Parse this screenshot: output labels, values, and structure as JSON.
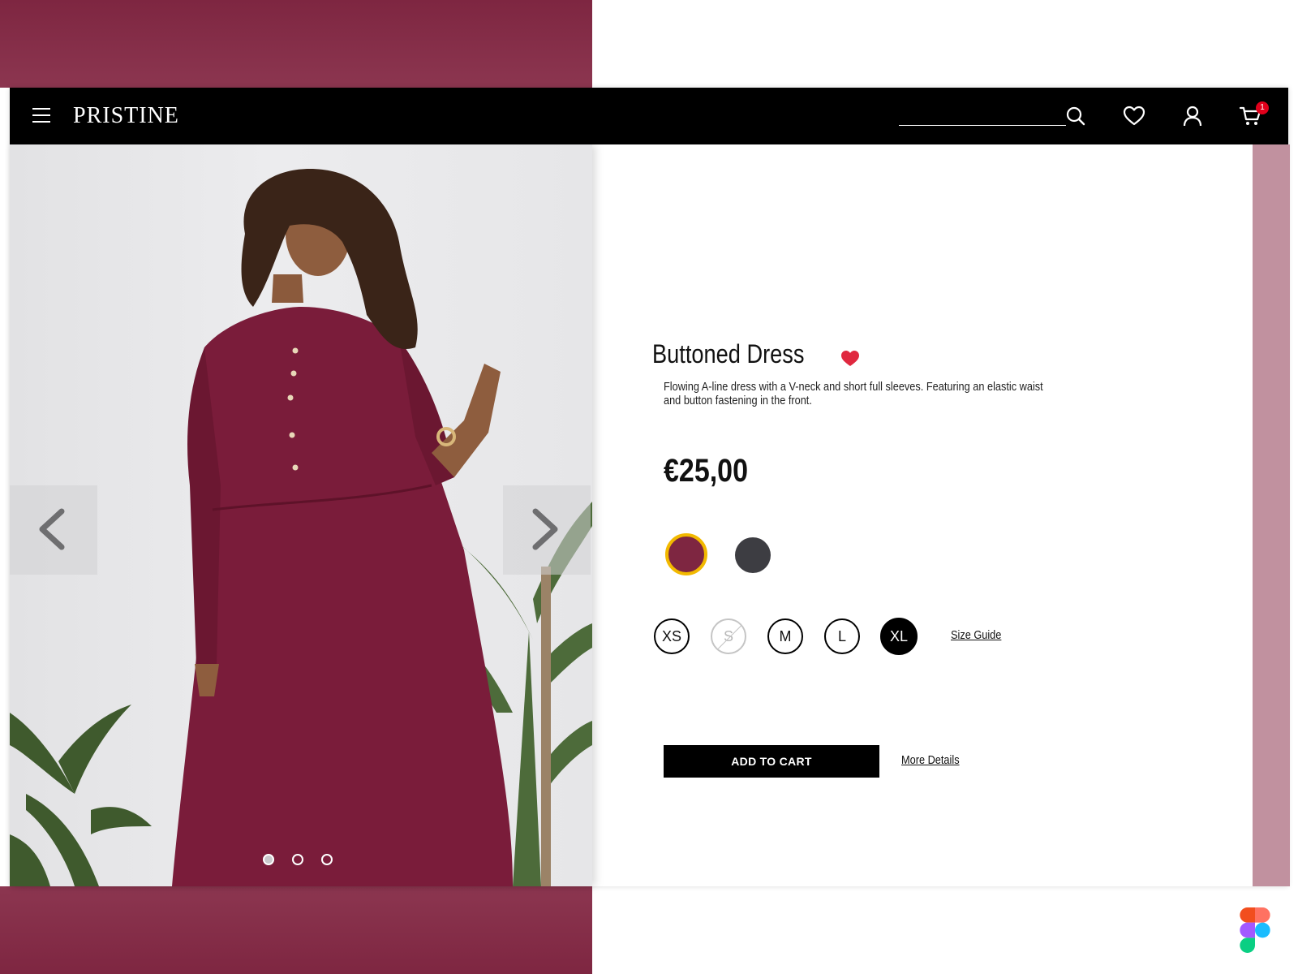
{
  "brand": "PRISTINE",
  "search": {
    "placeholder": ""
  },
  "cart": {
    "count": "1"
  },
  "product": {
    "title": "Buttoned Dress",
    "description": "Flowing A-line dress with a V-neck and short full sleeves. Featuring an elastic waist and button fastening in the front.",
    "price": "€25,00",
    "favorited": true,
    "colors": [
      {
        "name": "burgundy",
        "hex": "#7e2641",
        "selected": true
      },
      {
        "name": "charcoal",
        "hex": "#3d3d42",
        "selected": false
      }
    ],
    "sizes": [
      "XS",
      "S",
      "M",
      "L",
      "XL"
    ],
    "disabled_size": "S",
    "selected_size": "XL",
    "size_guide_label": "Size Guide",
    "add_to_cart_label": "ADD TO CART",
    "more_details_label": "More Details"
  },
  "carousel": {
    "slides": 3,
    "active": 1
  },
  "colors": {
    "accent": "#7e2641",
    "swatch_highlight": "#f2b900",
    "heart": "#e0283f",
    "badge": "#e0001b"
  }
}
